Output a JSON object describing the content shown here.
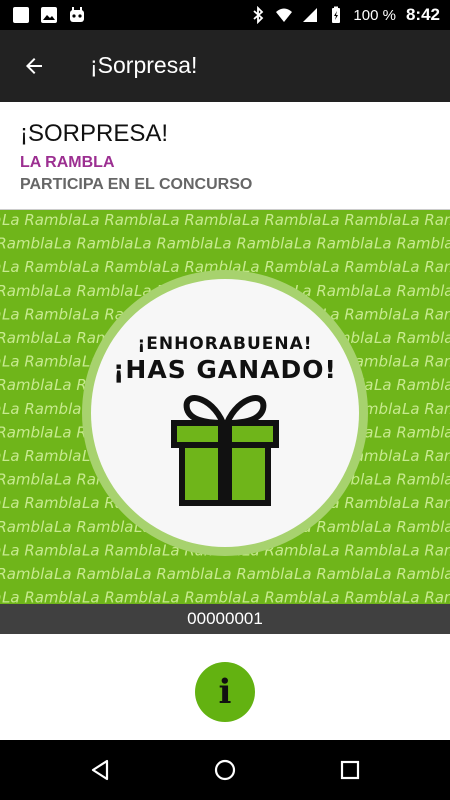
{
  "status_bar": {
    "battery": "100 %",
    "time": "8:42",
    "left_icons": [
      "app-square-icon",
      "image-icon",
      "android-robot-icon"
    ],
    "right_icons": [
      "bluetooth-icon",
      "wifi-icon",
      "signal-icon",
      "battery-icon"
    ]
  },
  "app_bar": {
    "back_icon": "arrow-left-icon",
    "title": "¡Sorpresa!"
  },
  "header": {
    "title": "¡SORPRESA!",
    "place": "LA RAMBLA",
    "subtitle": "PARTICIPA EN EL CONCURSO"
  },
  "prize": {
    "pattern_text": "La Rambla",
    "line1": "¡ENHORABUENA!",
    "line2": "¡HAS GANADO!",
    "icon": "gift-icon",
    "background_color": "#6fb51a",
    "accent_color": "#63b211"
  },
  "code": "00000001",
  "info_button": {
    "icon": "info-icon",
    "glyph": "i"
  },
  "nav": [
    "back-triangle-icon",
    "home-circle-icon",
    "recents-square-icon"
  ]
}
